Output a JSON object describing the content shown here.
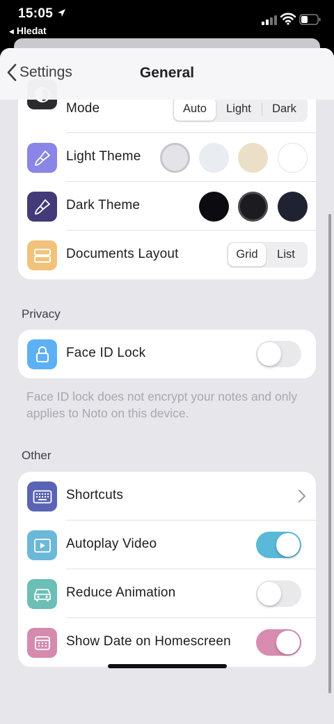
{
  "status": {
    "time": "15:05",
    "back_app": "Hledat"
  },
  "nav": {
    "back_label": "Settings",
    "title": "General"
  },
  "colors": {
    "accent": "#5ab8d8",
    "toggle_pink": "#d78cb0",
    "icon_mode": "#2b2b2e",
    "icon_light_theme": "#8a85e6",
    "icon_dark_theme": "#433a7a",
    "icon_layout": "#f2c27a",
    "icon_face_id": "#5eb0f5",
    "icon_shortcuts": "#5b63b5",
    "icon_autoplay": "#6bb8d9",
    "icon_reduce_animation": "#6bbfb4",
    "icon_show_date": "#d58aae"
  },
  "appearance": {
    "mode": {
      "label": "Mode",
      "icon": "half-circle-icon",
      "options": [
        "Auto",
        "Light",
        "Dark"
      ],
      "selected": "Auto"
    },
    "light_theme": {
      "label": "Light Theme",
      "icon": "paintbrush-icon",
      "swatches": [
        "#e3e3e8",
        "#e9ecf0",
        "#ecdfc8",
        "#ffffff"
      ],
      "selected_index": 0
    },
    "dark_theme": {
      "label": "Dark Theme",
      "icon": "paintbrush-icon",
      "swatches": [
        "#0c0c10",
        "#1c1c20",
        "#1f2230"
      ],
      "selected_index": 1
    },
    "documents_layout": {
      "label": "Documents Layout",
      "icon": "rows-icon",
      "options": [
        "Grid",
        "List"
      ],
      "selected": "Grid"
    }
  },
  "privacy": {
    "header": "Privacy",
    "face_id": {
      "label": "Face ID Lock",
      "icon": "lock-icon",
      "on": false
    },
    "footnote": "Face ID lock does not encrypt your notes and only applies to Noto on this device."
  },
  "other": {
    "header": "Other",
    "shortcuts": {
      "label": "Shortcuts",
      "icon": "keyboard-icon"
    },
    "autoplay_video": {
      "label": "Autoplay Video",
      "icon": "play-icon",
      "on": true
    },
    "reduce_animation": {
      "label": "Reduce Animation",
      "icon": "car-icon",
      "on": false
    },
    "show_date": {
      "label": "Show Date on Homescreen",
      "icon": "calendar-icon",
      "on": true
    }
  }
}
